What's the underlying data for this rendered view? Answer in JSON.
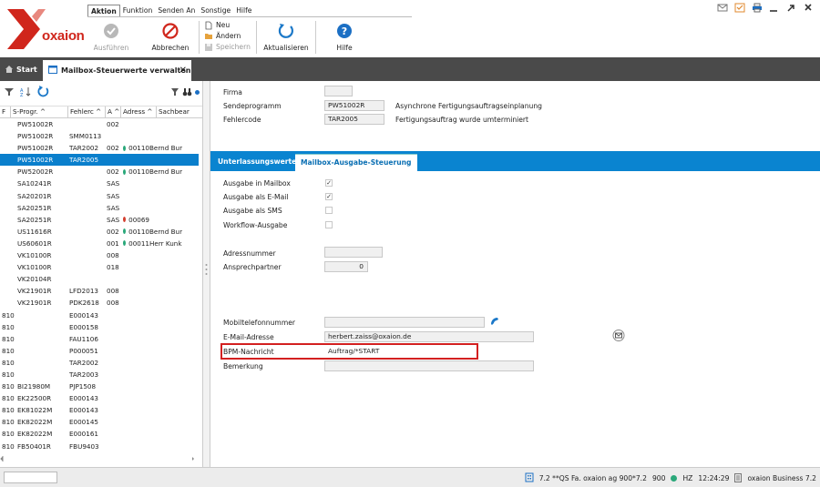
{
  "app": {
    "logo_text": "oxaion"
  },
  "menu": [
    "Aktion",
    "Funktion",
    "Senden An",
    "Sonstige",
    "Hilfe"
  ],
  "toolbar": {
    "ausfuehren": "Ausführen",
    "abbrechen": "Abbrechen",
    "neu": "Neu",
    "aendern": "Ändern",
    "speichern": "Speichern",
    "aktualisieren": "Aktualisieren",
    "hilfe": "Hilfe"
  },
  "tabs": {
    "start": "Start",
    "active": "Mailbox-Steuerwerte verwalten"
  },
  "grid": {
    "headers": [
      "F",
      "S-Progr.",
      "Fehlerc",
      "A",
      "Adress",
      "Sachbear"
    ],
    "rows": [
      [
        "",
        "PW51002R",
        "",
        "002",
        "",
        ""
      ],
      [
        "",
        "PW51002R",
        "SMM0113",
        "",
        "",
        ""
      ],
      [
        "",
        "PW51002R",
        "TAR2002",
        "002",
        "00110",
        "Bernd Bur"
      ],
      [
        "",
        "PW51002R",
        "TAR2005",
        "",
        "",
        ""
      ],
      [
        "",
        "PW52002R",
        "",
        "002",
        "00110",
        "Bernd Bur"
      ],
      [
        "",
        "SA10241R",
        "",
        "SAS",
        "",
        ""
      ],
      [
        "",
        "SA20201R",
        "",
        "SAS",
        "",
        ""
      ],
      [
        "",
        "SA20251R",
        "",
        "SAS",
        "",
        ""
      ],
      [
        "",
        "SA20251R",
        "",
        "SAS",
        "00069",
        ""
      ],
      [
        "",
        "US11616R",
        "",
        "002",
        "00110",
        "Bernd Bur"
      ],
      [
        "",
        "US60601R",
        "",
        "001",
        "00011",
        "Herr Kunk"
      ],
      [
        "",
        "VK10100R",
        "",
        "008",
        "",
        ""
      ],
      [
        "",
        "VK10100R",
        "",
        "018",
        "",
        ""
      ],
      [
        "",
        "VK20104R",
        "",
        "",
        "",
        ""
      ],
      [
        "",
        "VK21901R",
        "LFD2013",
        "008",
        "",
        ""
      ],
      [
        "",
        "VK21901R",
        "PDK2618",
        "008",
        "",
        ""
      ],
      [
        "810",
        "",
        "E000143",
        "",
        "",
        ""
      ],
      [
        "810",
        "",
        "E000158",
        "",
        "",
        ""
      ],
      [
        "810",
        "",
        "FAU1106",
        "",
        "",
        ""
      ],
      [
        "810",
        "",
        "P000051",
        "",
        "",
        ""
      ],
      [
        "810",
        "",
        "TAR2002",
        "",
        "",
        ""
      ],
      [
        "810",
        "",
        "TAR2003",
        "",
        "",
        ""
      ],
      [
        "810",
        "BI21980M",
        "PJP1508",
        "",
        "",
        ""
      ],
      [
        "810",
        "EK22500R",
        "E000143",
        "",
        "",
        ""
      ],
      [
        "810",
        "EK81022M",
        "E000143",
        "",
        "",
        ""
      ],
      [
        "810",
        "EK82022M",
        "E000145",
        "",
        "",
        ""
      ],
      [
        "810",
        "EK82022M",
        "E000161",
        "",
        "",
        ""
      ],
      [
        "810",
        "FB50401R",
        "FBU9403",
        "",
        "",
        ""
      ]
    ],
    "dot_colors": {
      "green": "#2aa87a",
      "red": "#d43f2f"
    }
  },
  "form": {
    "firma_label": "Firma",
    "firma_value": "",
    "sendeprogramm_label": "Sendeprogramm",
    "sendeprogramm_value": "PW51002R",
    "sendeprogramm_desc": "Asynchrone Fertigungsauftragseinplanung",
    "fehlercode_label": "Fehlercode",
    "fehlercode_value": "TAR2005",
    "fehlercode_desc": "Fertigungsauftrag wurde umterminiert"
  },
  "subtabs": [
    "Unterlassungswerte",
    "Mailbox-Ausgabe-Steuerung"
  ],
  "mailbox": {
    "ausgabe_mailbox": "Ausgabe in Mailbox",
    "ausgabe_email": "Ausgabe als E-Mail",
    "ausgabe_sms": "Ausgabe als SMS",
    "workflow": "Workflow-Ausgabe",
    "adressnummer_label": "Adressnummer",
    "ansprechpartner_label": "Ansprechpartner",
    "ansprechpartner_value": "0",
    "mobil_label": "Mobiltelefonnummer",
    "email_label": "E-Mail-Adresse",
    "email_value": "herbert.zaiss@oxaion.de",
    "bpm_label": "BPM-Nachricht",
    "bpm_value": "Auftrag/*START",
    "bemerkung_label": "Bemerkung",
    "checked": [
      true,
      true,
      false,
      false
    ]
  },
  "statusbar": {
    "version": "7.2 **QS Fa. oxaion ag 900*7.2",
    "firm": "900",
    "hz": "HZ",
    "time": "12:24:29",
    "product": "oxaion Business 7.2"
  },
  "colors": {
    "accent": "#0a84d0",
    "brand": "#d0261c",
    "highlight": "#d32020"
  }
}
